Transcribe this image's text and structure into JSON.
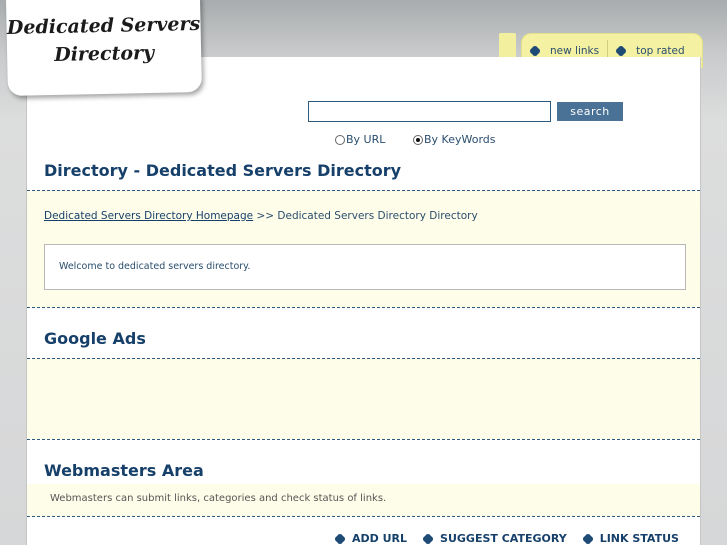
{
  "logo": {
    "line1": "Dedicated Servers",
    "line2": "Directory"
  },
  "top_tabs": [
    {
      "label": "new links"
    },
    {
      "label": "top rated"
    }
  ],
  "search": {
    "value": "",
    "button_label": "search"
  },
  "search_options": [
    {
      "label": "By URL",
      "checked": false
    },
    {
      "label": "By KeyWords",
      "checked": true
    }
  ],
  "directory": {
    "title": "Directory - Dedicated Servers Directory",
    "breadcrumb_link": "Dedicated Servers Directory Homepage",
    "breadcrumb_rest": " >> Dedicated Servers Directory Directory",
    "welcome_text": "Welcome to dedicated servers directory."
  },
  "google_ads": {
    "title": "Google Ads"
  },
  "webmasters": {
    "title": "Webmasters Area",
    "description": "Webmasters can submit links, categories and check status of links."
  },
  "bottom_links": [
    {
      "label": "ADD URL"
    },
    {
      "label": "SUGGEST CATEGORY"
    },
    {
      "label": "LINK STATUS"
    }
  ]
}
